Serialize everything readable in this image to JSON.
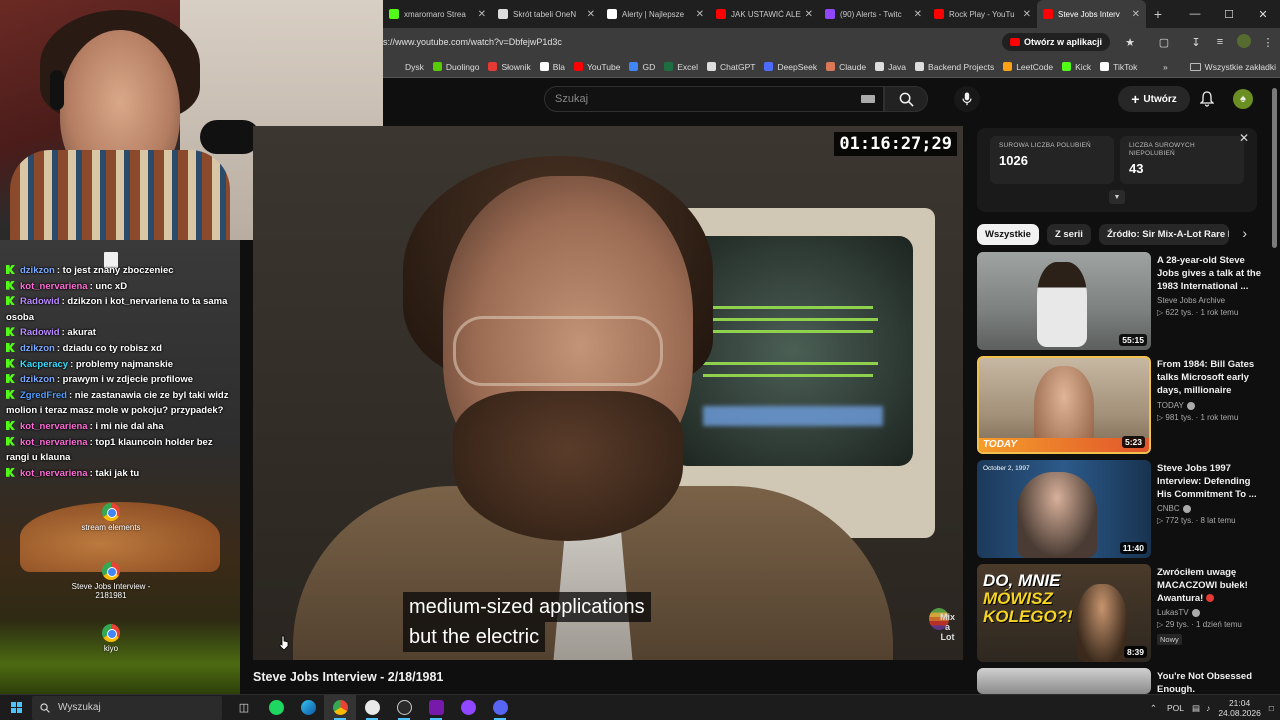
{
  "browser": {
    "tabs": [
      {
        "title": "xmaromaro Strea",
        "icon_color": "#53fc18",
        "active": false
      },
      {
        "title": "Skrót tabeli OneN",
        "icon_color": "#dddddd",
        "active": false
      },
      {
        "title": "Alerty | Najlepsze",
        "icon_color": "#ffffff",
        "active": false
      },
      {
        "title": "JAK USTAWIĆ ALE",
        "icon_color": "#ff0000",
        "active": false
      },
      {
        "title": "(90) Alerts - Twitc",
        "icon_color": "#9146ff",
        "active": false
      },
      {
        "title": "Rock Play - YouTu",
        "icon_color": "#ff0000",
        "active": false
      },
      {
        "title": "Steve Jobs Interv",
        "icon_color": "#ff0000",
        "active": true
      }
    ],
    "url": "s://www.youtube.com/watch?v=DbfejwP1d3c",
    "open_in_app": "Otwórz w aplikacji",
    "bookmarks": [
      {
        "label": "Dysk",
        "color": "#3c3c3c"
      },
      {
        "label": "Duolingo",
        "color": "#58cc02"
      },
      {
        "label": "Słownik",
        "color": "#e53935"
      },
      {
        "label": "Bla",
        "color": "#ffffff"
      },
      {
        "label": "YouTube",
        "color": "#ff0000"
      },
      {
        "label": "GD",
        "color": "#4285f4"
      },
      {
        "label": "Excel",
        "color": "#1d6f42"
      },
      {
        "label": "ChatGPT",
        "color": "#dddddd"
      },
      {
        "label": "DeepSeek",
        "color": "#4d6bfe"
      },
      {
        "label": "Claude",
        "color": "#d97757"
      },
      {
        "label": "Java",
        "color": "#dddddd"
      },
      {
        "label": "Backend Projects",
        "color": "#dddddd"
      },
      {
        "label": "LeetCode",
        "color": "#ffa116"
      },
      {
        "label": "Kick",
        "color": "#53fc18"
      },
      {
        "label": "TikTok",
        "color": "#ffffff"
      }
    ],
    "all_bookmarks": "Wszystkie zakładki"
  },
  "youtube": {
    "search_placeholder": "Szukaj",
    "create_label": "Utwórz",
    "video_title": "Steve Jobs Interview - 2/18/1981",
    "timecode": "01:16:27;29",
    "captions": [
      "medium-sized applications",
      "but the electric"
    ],
    "watermark": "Mix\na\nLot",
    "rtd": {
      "likes_label": "SUROWA LICZBA POLUBIEŃ",
      "likes_value": "1026",
      "dislikes_label": "LICZBA SUROWYCH NIEPOLUBIEŃ",
      "dislikes_value": "43"
    },
    "chips": [
      "Wszystkie",
      "Z serii",
      "Źródło: Sir Mix-A-Lot Rare Mu"
    ],
    "recommendations": [
      {
        "title": "A 28-year-old Steve Jobs gives a talk at the 1983 International ...",
        "channel": "Steve Jobs Archive",
        "meta": "▷ 622 tys. · 1 rok temu",
        "duration": "55:15",
        "verified": false
      },
      {
        "title": "From 1984: Bill Gates talks Microsoft early days, millionaire status",
        "channel": "TODAY",
        "meta": "▷ 981 tys. · 1 rok temu",
        "duration": "5:23",
        "verified": true
      },
      {
        "title": "Steve Jobs 1997 Interview: Defending His Commitment To ...",
        "channel": "CNBC",
        "meta": "▷ 772 tys. · 8 lat temu",
        "duration": "11:40",
        "verified": true,
        "thumb_caption": "October 2, 1997"
      },
      {
        "title": "Zwróciłem uwagę MACACZOWI bułek! Awantura!",
        "channel": "LukasTV",
        "meta": "▷ 29 tys. · 1 dzień temu",
        "duration": "8:39",
        "verified": true,
        "badge": "Nowy",
        "thumb_text_1": "DO, MNIE",
        "thumb_text_2": "MÓWISZ KOLEGO?!"
      },
      {
        "title": "You're Not Obsessed Enough.",
        "channel": "",
        "meta": "",
        "duration": ""
      }
    ],
    "today_logo": "TODAY"
  },
  "chat": [
    {
      "user": "dzikzon",
      "msg": "to jest znany zboczeniec",
      "cls": "c-dzikzon"
    },
    {
      "user": "kot_nervariena",
      "msg": "unc xD",
      "cls": "c-kot"
    },
    {
      "user": "Radowid",
      "msg": "dzikzon i kot_nervariena to ta sama osoba",
      "cls": "c-radowid"
    },
    {
      "user": "Radowid",
      "msg": "akurat",
      "cls": "c-radowid"
    },
    {
      "user": "dzikzon",
      "msg": "dziadu co ty robisz xd",
      "cls": "c-dzikzon"
    },
    {
      "user": "Kacperacy",
      "msg": "problemy najmanskie",
      "cls": "c-kacperacy"
    },
    {
      "user": "dzikzon",
      "msg": "prawym i w zdjecie profilowe",
      "cls": "c-dzikzon"
    },
    {
      "user": "ZgredFred",
      "msg": "nie zastanawia cie ze byl taki widz molion i teraz masz mole w pokoju? przypadek?",
      "cls": "c-zgred"
    },
    {
      "user": "kot_nervariena",
      "msg": "i mi nie dal aha",
      "cls": "c-kot"
    },
    {
      "user": "kot_nervariena",
      "msg": "top1 klauncoin holder bez rangi u klauna",
      "cls": "c-kot"
    },
    {
      "user": "kot_nervariena",
      "msg": "taki jak tu",
      "cls": "c-kot"
    }
  ],
  "desktop_icons": [
    "stream elements",
    "Steve Jobs Interview - 2181981",
    "kiyo"
  ],
  "taskbar": {
    "search": "Wyszukaj",
    "lang": "POL",
    "time": "21:04",
    "date": "24.08.2026"
  }
}
